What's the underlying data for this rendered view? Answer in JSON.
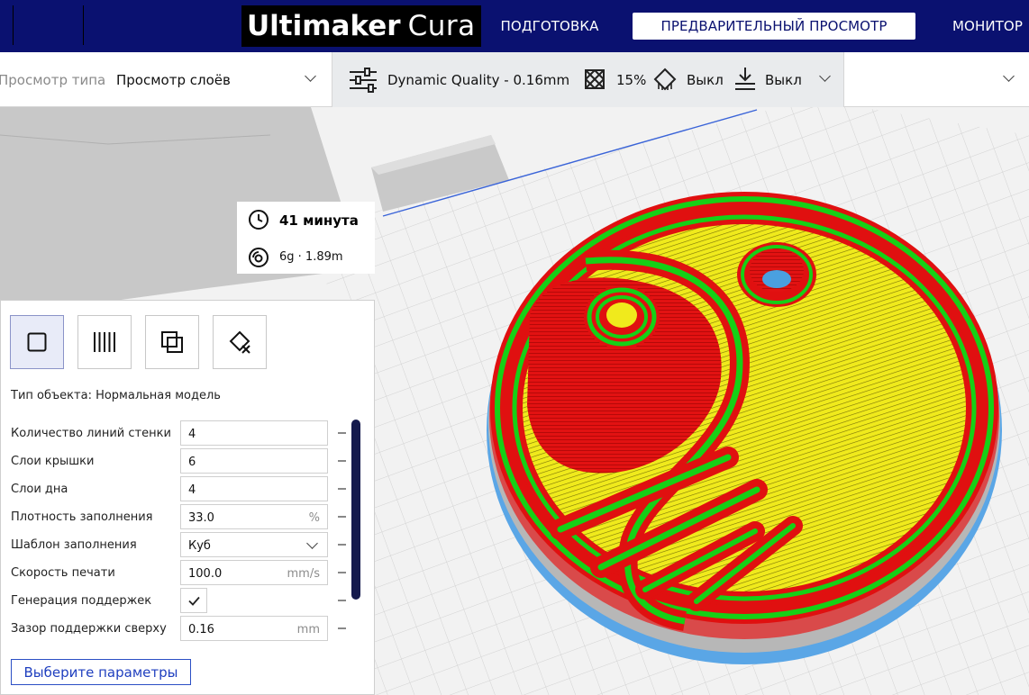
{
  "app": {
    "brand_bold": "Ultimaker",
    "brand_light": "Cura",
    "tabs": [
      {
        "label": "ПОДГОТОВКА",
        "active": false
      },
      {
        "label": "ПРЕДВАРИТЕЛЬНЫЙ ПРОСМОТР",
        "active": true
      },
      {
        "label": "МОНИТОР",
        "active": false
      }
    ]
  },
  "view_type": {
    "label": "Просмотр типа",
    "value": "Просмотр слоёв"
  },
  "print_setup": {
    "profile": "Dynamic Quality - 0.16mm",
    "infill": "15%",
    "support": "Выкл",
    "adhesion": "Выкл",
    "icons": [
      "print-settings-icon",
      "infill-icon",
      "support-icon",
      "adhesion-icon"
    ]
  },
  "estimate": {
    "time": "41 минута",
    "material": "6g · 1.89m"
  },
  "panel": {
    "object_type": "Тип объекта: Нормальная модель",
    "settings": [
      {
        "label": "Количество линий стенки",
        "value": "4",
        "unit": ""
      },
      {
        "label": "Слои крышки",
        "value": "6",
        "unit": ""
      },
      {
        "label": "Слои дна",
        "value": "4",
        "unit": ""
      },
      {
        "label": "Плотность заполнения",
        "value": "33.0",
        "unit": "%"
      },
      {
        "label": "Шаблон заполнения",
        "value": "Куб",
        "unit": ""
      },
      {
        "label": "Скорость печати",
        "value": "100.0",
        "unit": "mm/s"
      },
      {
        "label": "Генерация поддержек",
        "value": "",
        "unit": "",
        "checked": true
      },
      {
        "label": "Зазор поддержки сверху",
        "value": "0.16",
        "unit": "mm"
      }
    ],
    "choose_button": "Выберите параметры"
  },
  "colors": {
    "header": "#0a1170",
    "wall_outer": "#e01010",
    "wall_inner": "#16d016",
    "infill": "#f0ea1c",
    "accent": "#1f3fbf"
  }
}
